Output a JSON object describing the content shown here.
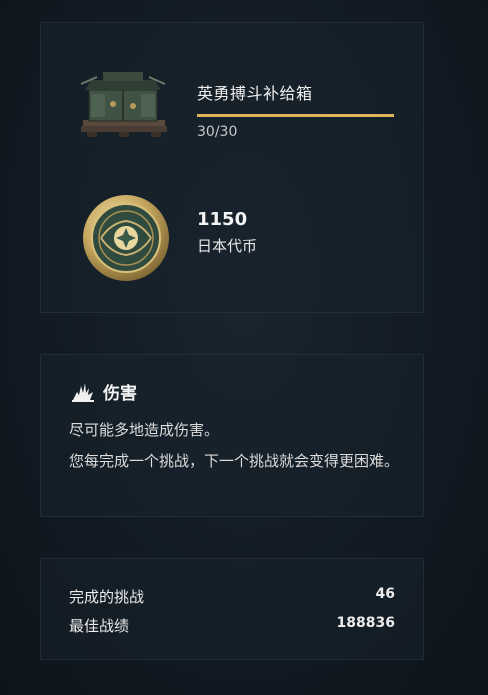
{
  "rewards": {
    "crate": {
      "title": "英勇搏斗补给箱",
      "progress_text": "30/30",
      "progress_fraction": 1.0,
      "icon": "supply-crate-icon"
    },
    "coin": {
      "amount": "1150",
      "label": "日本代币",
      "icon": "japanese-token-icon"
    }
  },
  "task": {
    "icon": "damage-icon",
    "title": "伤害",
    "description": "尽可能多地造成伤害。",
    "note": "您每完成一个挑战，下一个挑战就会变得更困难。"
  },
  "stats": {
    "completed_label": "完成的挑战",
    "completed_value": "46",
    "best_label": "最佳战绩",
    "best_value": "188836"
  },
  "colors": {
    "accent": "#e0b45c",
    "panel_bg": "#18222c",
    "background": "#101820"
  }
}
